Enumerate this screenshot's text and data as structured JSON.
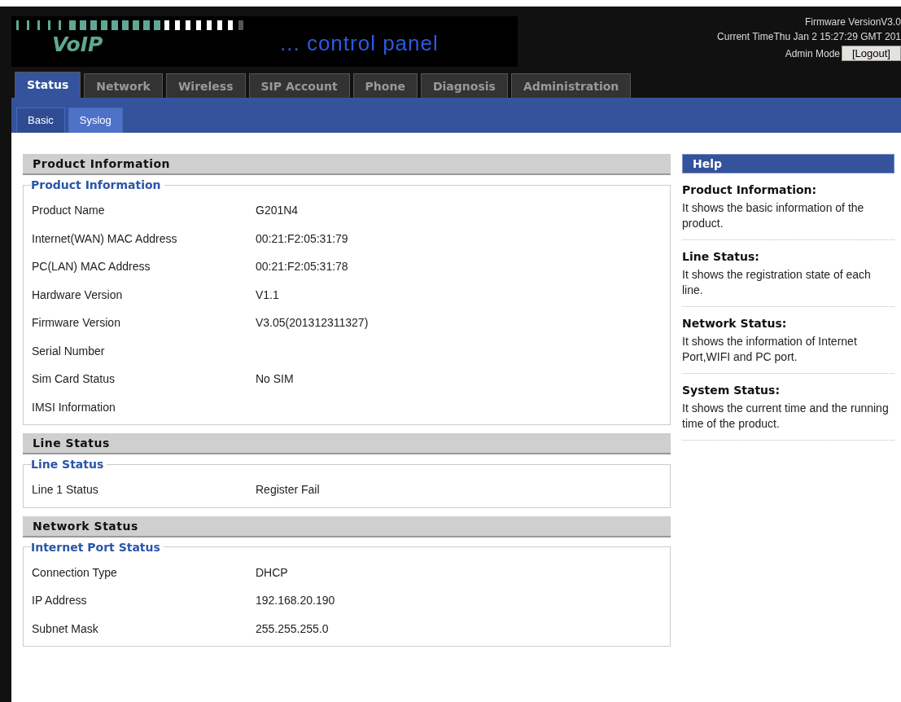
{
  "header": {
    "logo": "VoIP",
    "tagline": "... control panel",
    "firmware": "Firmware VersionV3.0",
    "time": "Current TimeThu Jan 2 15:27:29 GMT 201",
    "mode": "Admin Mode",
    "logout": "[Logout]"
  },
  "tabs": [
    {
      "label": "Status",
      "selected": true
    },
    {
      "label": "Network",
      "selected": false
    },
    {
      "label": "Wireless",
      "selected": false
    },
    {
      "label": "SIP Account",
      "selected": false
    },
    {
      "label": "Phone",
      "selected": false
    },
    {
      "label": "Diagnosis",
      "selected": false
    },
    {
      "label": "Administration",
      "selected": false
    }
  ],
  "subtabs": [
    {
      "label": "Basic",
      "selected": true
    },
    {
      "label": "Syslog",
      "selected": false
    }
  ],
  "sections": [
    {
      "title": "Product Information",
      "groups": [
        {
          "legend": "Product Information",
          "rows": [
            {
              "label": "Product Name",
              "value": "G201N4"
            },
            {
              "label": "Internet(WAN) MAC Address",
              "value": "00:21:F2:05:31:79"
            },
            {
              "label": "PC(LAN) MAC Address",
              "value": "00:21:F2:05:31:78"
            },
            {
              "label": "Hardware Version",
              "value": "V1.1"
            },
            {
              "label": "Firmware Version",
              "value": "V3.05(201312311327)"
            },
            {
              "label": "Serial Number"
            },
            {
              "label": "Sim Card Status",
              "value": "No SIM"
            },
            {
              "label": "IMSI Information"
            }
          ]
        }
      ]
    },
    {
      "title": "Line Status",
      "groups": [
        {
          "legend": "Line Status",
          "rows": [
            {
              "label": "Line 1 Status",
              "value": "Register Fail"
            }
          ]
        }
      ]
    },
    {
      "title": "Network Status",
      "groups": [
        {
          "legend": "Internet Port Status",
          "rows": [
            {
              "label": "Connection Type",
              "value": "DHCP"
            },
            {
              "label": "IP Address",
              "value": "192.168.20.190"
            },
            {
              "label": "Subnet Mask",
              "value": "255.255.255.0"
            }
          ]
        }
      ]
    }
  ],
  "help": {
    "title": "Help",
    "items": [
      {
        "heading": "Product Information:",
        "text": "It shows the basic information of the product."
      },
      {
        "heading": "Line Status:",
        "text": "It shows the registration state of each line."
      },
      {
        "heading": "Network Status:",
        "text": "It shows the information of Internet Port,WIFI and PC port."
      },
      {
        "heading": "System Status:",
        "text": "It shows the current time and the running time of the product."
      }
    ]
  }
}
